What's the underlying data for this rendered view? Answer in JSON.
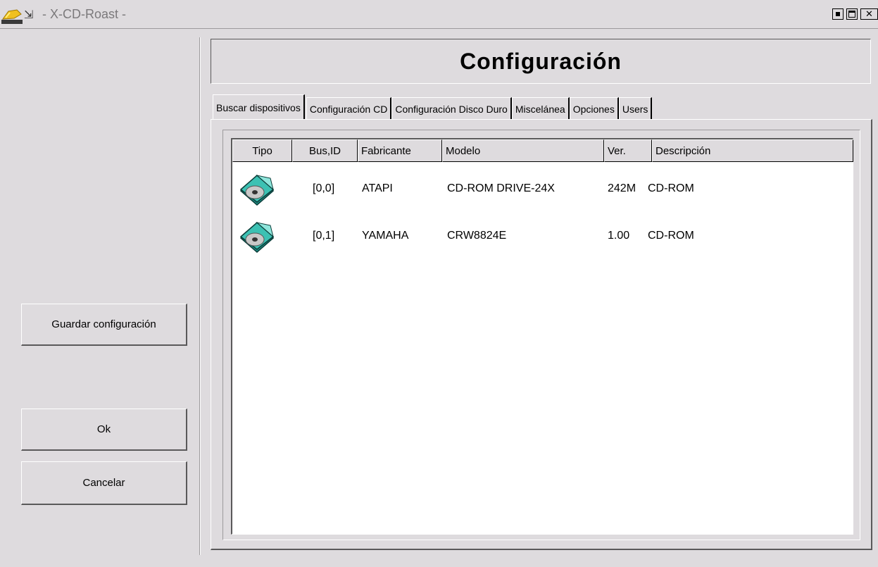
{
  "window": {
    "title": "- X-CD-Roast -",
    "pin_glyph": "⇲"
  },
  "left_panel": {
    "save_label": "Guardar configuración",
    "ok_label": "Ok",
    "cancel_label": "Cancelar"
  },
  "header": {
    "title": "Configuración"
  },
  "tabs": [
    {
      "label": "Buscar dispositivos",
      "active": true
    },
    {
      "label": "Configuración CD"
    },
    {
      "label": "Configuración Disco Duro"
    },
    {
      "label": "Miscelánea"
    },
    {
      "label": "Opciones"
    },
    {
      "label": "Users"
    }
  ],
  "table": {
    "columns": [
      "Tipo",
      "Bus,ID",
      "Fabricante",
      "Modelo",
      "Ver.",
      "Descripción"
    ],
    "rows": [
      {
        "icon": "cdrom-icon",
        "bus_id": "[0,0]",
        "manufacturer": "ATAPI",
        "model": "CD-ROM DRIVE-24X",
        "version": "242M",
        "description": "CD-ROM"
      },
      {
        "icon": "cdrom-icon",
        "bus_id": "[0,1]",
        "manufacturer": "YAMAHA",
        "model": "CRW8824E",
        "version": "1.00",
        "description": "CD-ROM"
      }
    ]
  },
  "colors": {
    "background": "#dedbde",
    "list_background": "#ffffff",
    "icon_teal": "#2aa79b"
  }
}
